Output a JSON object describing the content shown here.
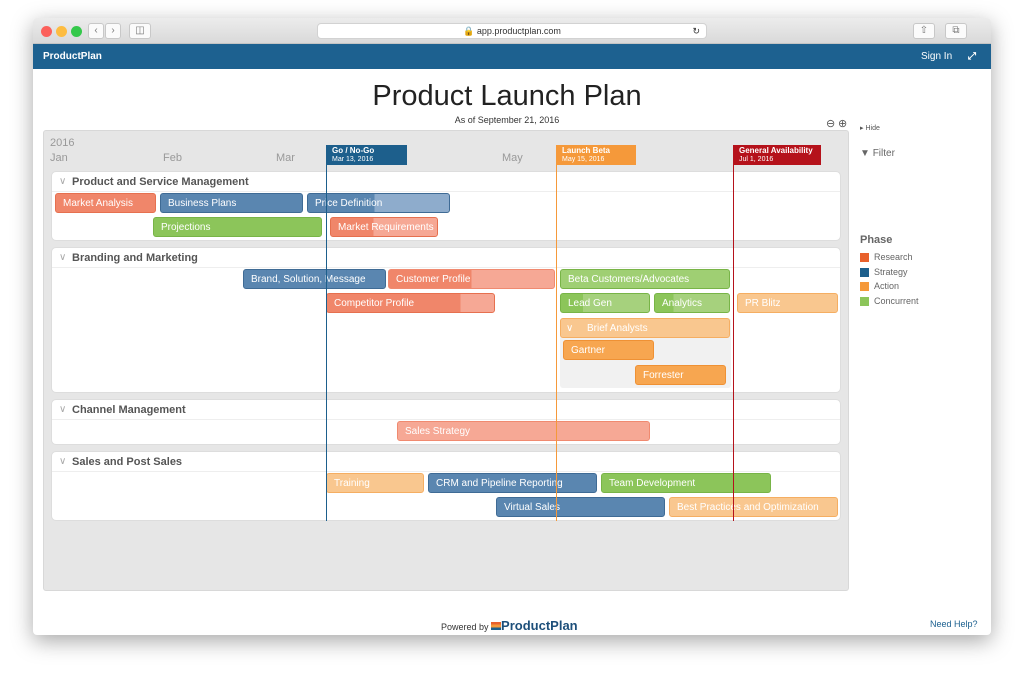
{
  "browser": {
    "url": "app.productplan.com"
  },
  "app": {
    "brand": "ProductPlan",
    "sign_in": "Sign In"
  },
  "plan": {
    "title": "Product Launch Plan",
    "as_of": "As of September 21, 2016"
  },
  "timeline": {
    "year": "2016",
    "months": [
      "Jan",
      "Feb",
      "Mar",
      "May"
    ]
  },
  "milestones": [
    {
      "name": "Go / No-Go",
      "date": "Mar 13, 2016",
      "color": "#1d5f8c"
    },
    {
      "name": "Launch Beta",
      "date": "May 15, 2016",
      "color": "#f5993a"
    },
    {
      "name": "General Availability",
      "date": "Jul 1, 2016",
      "color": "#b5121b"
    }
  ],
  "groups": [
    {
      "name": "Product and Service Management",
      "bars": [
        "Market Analysis",
        "Business Plans",
        "Price Definition",
        "Projections",
        "Market Requirements"
      ]
    },
    {
      "name": "Branding and Marketing",
      "bars": [
        "Brand, Solution, Message",
        "Customer Profile",
        "Beta Customers/Advocates",
        "Competitor Profile",
        "Lead Gen",
        "Analytics",
        "PR Blitz",
        "Brief Analysts",
        "Gartner",
        "Forrester"
      ]
    },
    {
      "name": "Channel Management",
      "bars": [
        "Sales Strategy"
      ]
    },
    {
      "name": "Sales and Post Sales",
      "bars": [
        "Training",
        "CRM and Pipeline Reporting",
        "Team Development",
        "Virtual Sales",
        "Best Practices and Optimization"
      ]
    }
  ],
  "sidebar": {
    "hide": "Hide",
    "filter": "Filter",
    "legend_title": "Phase",
    "legend": [
      {
        "label": "Research",
        "color": "#e8612c"
      },
      {
        "label": "Strategy",
        "color": "#1d5f8c"
      },
      {
        "label": "Action",
        "color": "#f5993a"
      },
      {
        "label": "Concurrent",
        "color": "#8cc55a"
      }
    ]
  },
  "footer": {
    "powered_by": "Powered by",
    "brand": "ProductPlan",
    "help": "Need Help?"
  }
}
